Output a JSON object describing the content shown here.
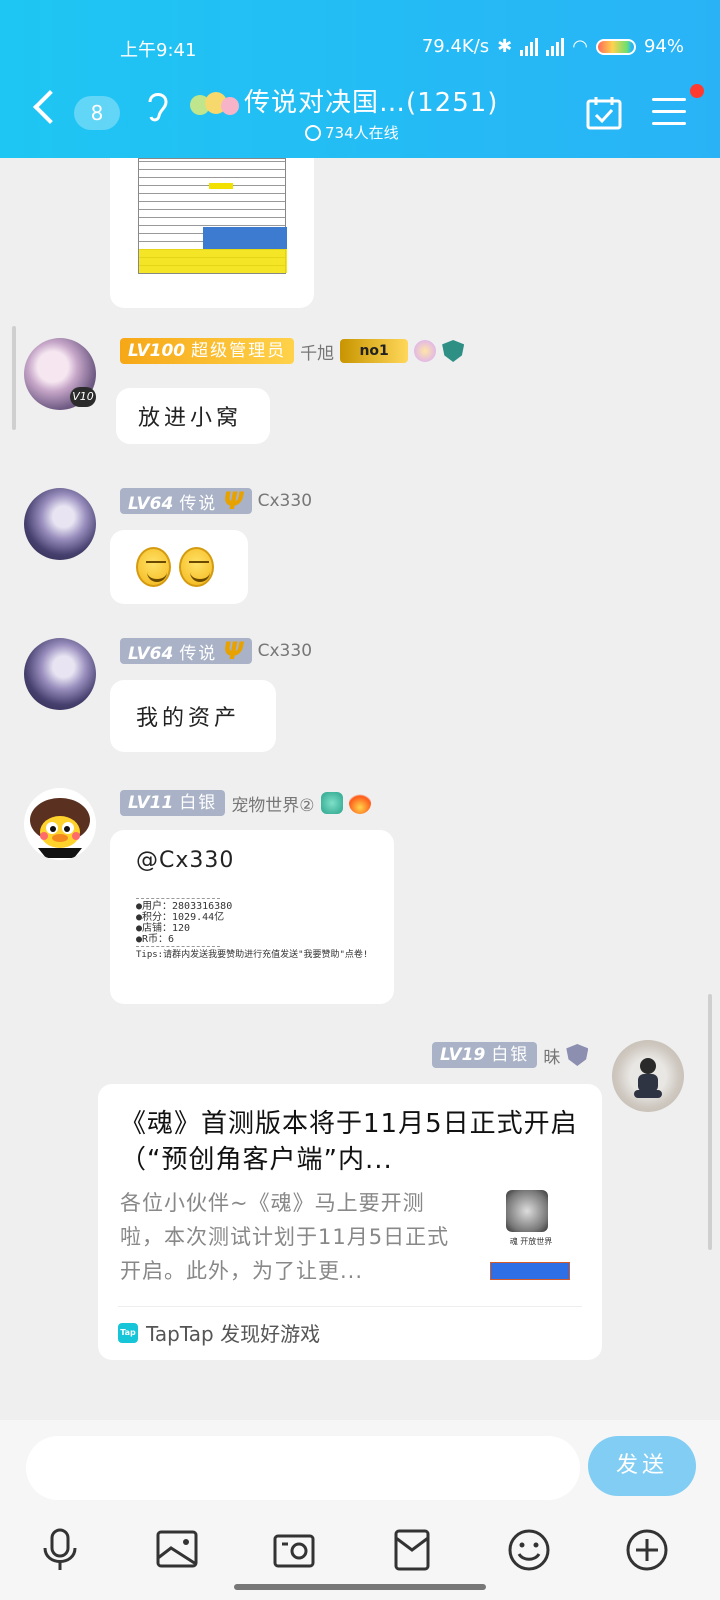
{
  "status_bar": {
    "time": "上午9:41",
    "net_speed": "79.4K/s",
    "signal1": "HD",
    "signal2": "HD",
    "battery": "94%"
  },
  "header": {
    "unread_count": "8",
    "title": "传说对决国…(1251)",
    "online": "734人在线"
  },
  "messages": [
    {
      "level": "LV100",
      "rank": "超级管理员",
      "nickname": "千旭",
      "badge_text": "no1",
      "avatar_badge": "V10",
      "text": "放进小窝"
    },
    {
      "level": "LV64",
      "rank": "传说",
      "nickname": "Cx330",
      "text": ""
    },
    {
      "level": "LV64",
      "rank": "传说",
      "nickname": "Cx330",
      "text": "我的资产"
    },
    {
      "level": "LV11",
      "rank": "白银",
      "nickname": "宠物世界②",
      "text": "@Cx330",
      "image_lines": [
        "●用户：2803316380",
        "●积分：1029.44亿",
        "●店铺：120",
        "●R币：6"
      ],
      "image_tips": "Tips:请群内发送我要赞助进行充值发送\"我要赞助\"点卷!"
    },
    {
      "level": "LV19",
      "rank": "白银",
      "nickname": "昧",
      "card": {
        "title": "《魂》首测版本将于11月5日正式开启（“预创角客户端”内...",
        "description": "各位小伙伴~《魂》马上要开测啦，本次测试计划于11月5日正式开启。此外，为了让更...",
        "source": "TapTap 发现好游戏",
        "source_logo": "Tap",
        "thumb_caption": "魂 开放世界"
      }
    }
  ],
  "input": {
    "placeholder": "",
    "send_label": "发送"
  },
  "colors": {
    "header_start": "#1ec6f3",
    "header_end": "#29b3f6",
    "send_button": "#82cdf4"
  }
}
